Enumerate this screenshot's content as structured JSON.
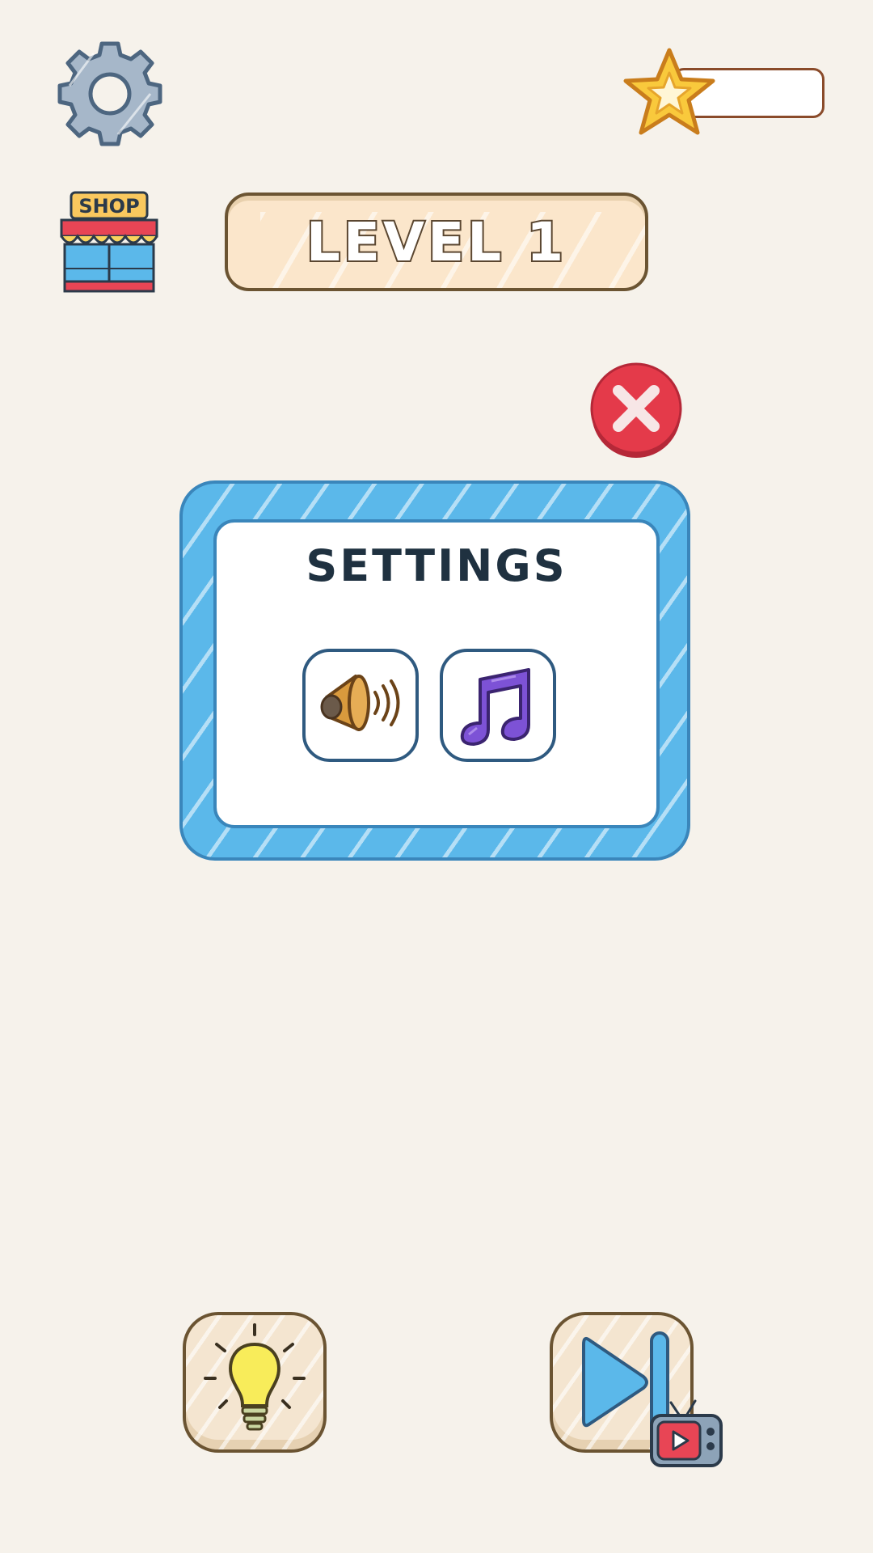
{
  "hud": {
    "settings_icon": "gear-icon",
    "star_icon": "star-icon",
    "star_score": "",
    "shop_label": "SHOP",
    "level_label": "LEVEL 1"
  },
  "settings_dialog": {
    "title": "SETTINGS",
    "close_icon": "close-icon",
    "sound_icon": "speaker-icon",
    "music_icon": "music-note-icon"
  },
  "bottom_bar": {
    "hint_icon": "lightbulb-icon",
    "skip_icon": "skip-forward-icon",
    "ad_icon": "tv-play-icon"
  },
  "colors": {
    "background": "#f6f2eb",
    "panel_blue": "#5bb8ea",
    "close_red": "#e43a4a",
    "star_yellow": "#f9c93c",
    "music_purple": "#7d52d6",
    "speaker_orange": "#d99a3d"
  }
}
